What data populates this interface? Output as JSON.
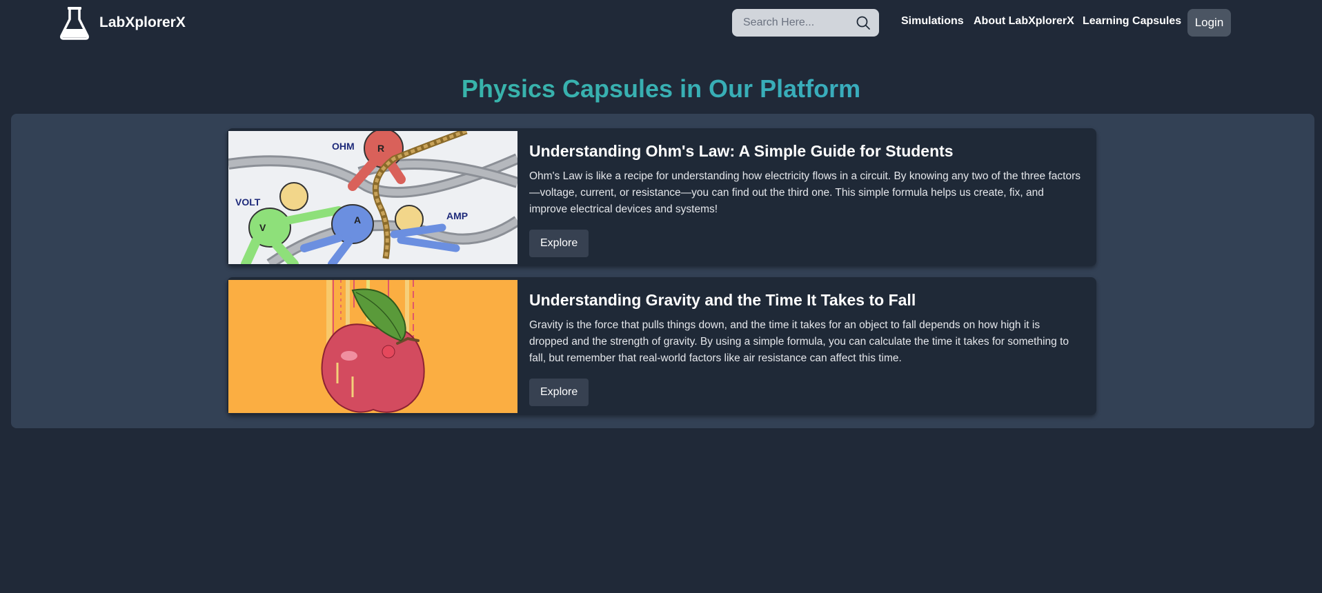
{
  "header": {
    "brand": "LabXplorerX",
    "search_placeholder": "Search Here...",
    "nav": [
      "Simulations",
      "About LabXplorerX",
      "Learning Capsules"
    ],
    "login": "Login"
  },
  "main": {
    "title": "Physics Capsules in Our Platform",
    "capsules": [
      {
        "title": "Understanding Ohm's Law: A Simple Guide for Students",
        "description": "Ohm's Law is like a recipe for understanding how electricity flows in a circuit. By knowing any two of the three factors—voltage, current, or resistance—you can find out the third one. This simple formula helps us create, fix, and improve electrical devices and systems!",
        "button": "Explore",
        "illustration_labels": [
          "OHM",
          "R",
          "VOLT",
          "V",
          "A",
          "AMP"
        ]
      },
      {
        "title": "Understanding Gravity and the Time It Takes to Fall",
        "description": "Gravity is the force that pulls things down, and the time it takes for an object to fall depends on how high it is dropped and the strength of gravity. By using a simple formula, you can calculate the time it takes for something to fall, but remember that real-world factors like air resistance can affect this time.",
        "button": "Explore"
      }
    ]
  },
  "colors": {
    "background": "#202938",
    "panel": "#334155",
    "card": "#1f2937",
    "title_gradient_start": "#34c3a0",
    "title_gradient_end": "#3aa3d4"
  }
}
